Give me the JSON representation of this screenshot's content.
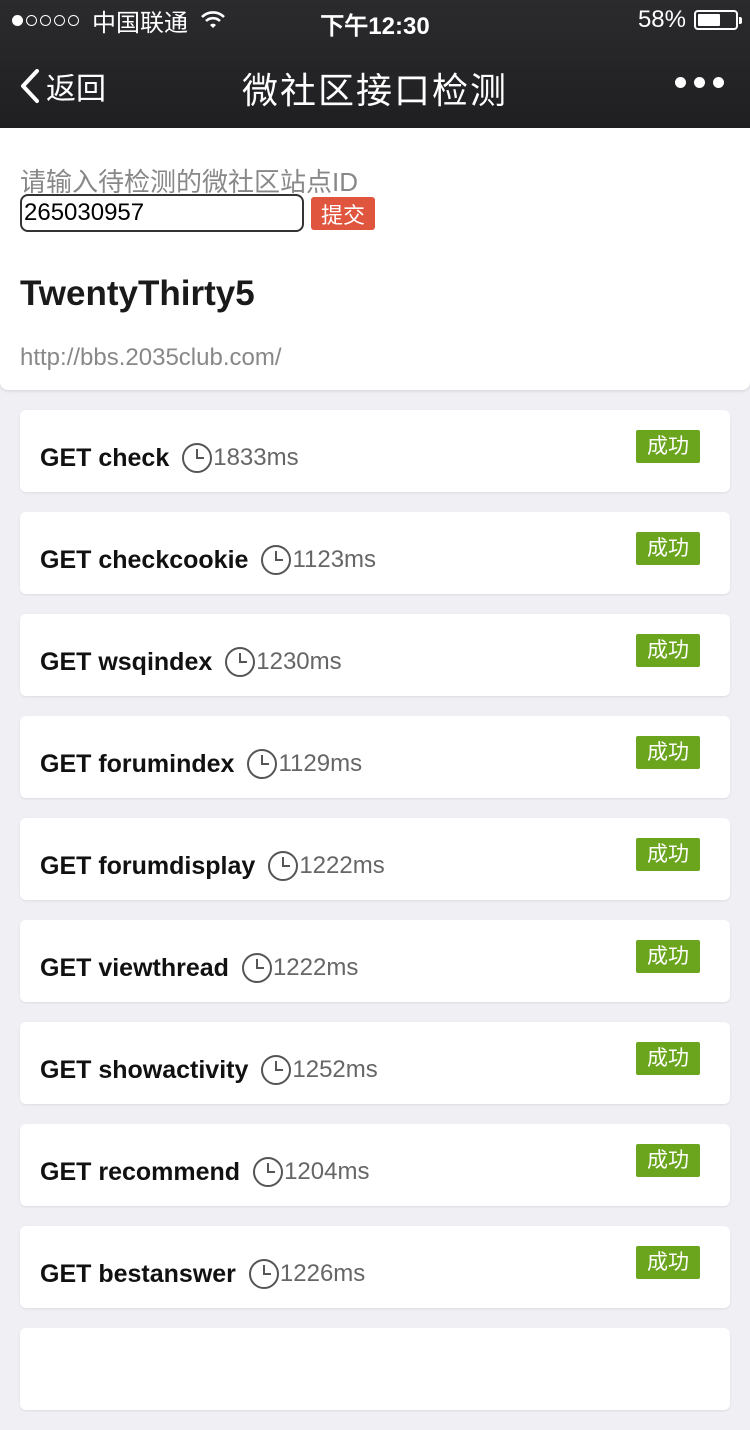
{
  "status_bar": {
    "carrier": "中国联通",
    "time": "下午12:30",
    "battery": "58%"
  },
  "nav": {
    "back_label": "返回",
    "title": "微社区接口检测"
  },
  "form": {
    "prompt": "请输入待检测的微社区站点ID",
    "site_id": "265030957",
    "submit_label": "提交"
  },
  "site": {
    "name": "TwentyThirty5",
    "url": "http://bbs.2035club.com/"
  },
  "results": [
    {
      "method": "GET check",
      "time": "1833ms",
      "status": "成功"
    },
    {
      "method": "GET checkcookie",
      "time": "1123ms",
      "status": "成功"
    },
    {
      "method": "GET wsqindex",
      "time": "1230ms",
      "status": "成功"
    },
    {
      "method": "GET forumindex",
      "time": "1129ms",
      "status": "成功"
    },
    {
      "method": "GET forumdisplay",
      "time": "1222ms",
      "status": "成功"
    },
    {
      "method": "GET viewthread",
      "time": "1222ms",
      "status": "成功"
    },
    {
      "method": "GET showactivity",
      "time": "1252ms",
      "status": "成功"
    },
    {
      "method": "GET recommend",
      "time": "1204ms",
      "status": "成功"
    },
    {
      "method": "GET bestanswer",
      "time": "1226ms",
      "status": "成功"
    }
  ],
  "colors": {
    "header": "#1f1f22",
    "submit": "#e0553d",
    "success": "#6aa51d",
    "background": "#efeff4"
  }
}
